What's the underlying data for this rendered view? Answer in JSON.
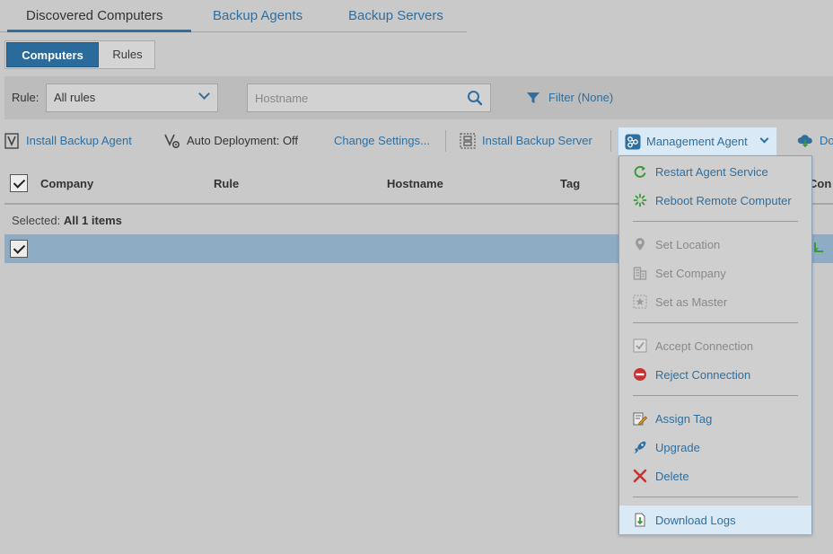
{
  "tabs": [
    {
      "label": "Discovered Computers",
      "active": true
    },
    {
      "label": "Backup Agents",
      "active": false
    },
    {
      "label": "Backup Servers",
      "active": false
    }
  ],
  "view_toggle": {
    "computers": "Computers",
    "rules": "Rules",
    "active": "Computers"
  },
  "filters": {
    "rule_label": "Rule:",
    "rule_value": "All rules",
    "search_placeholder": "Hostname",
    "filter_label": "Filter (None)"
  },
  "toolbar": {
    "install_agent": "Install Backup Agent",
    "auto_deployment": "Auto Deployment: Off",
    "change_settings": "Change Settings...",
    "install_server": "Install Backup Server",
    "management_agent": "Management Agent",
    "cut_off_item": "Do"
  },
  "table": {
    "columns": [
      "Company",
      "Rule",
      "Hostname",
      "Tag",
      "Con"
    ],
    "selected_prefix": "Selected:",
    "selected_value": "All 1 items"
  },
  "menu": {
    "items": [
      {
        "label": "Restart Agent Service",
        "icon": "restart-icon",
        "enabled": true
      },
      {
        "label": "Reboot Remote Computer",
        "icon": "reboot-icon",
        "enabled": true
      },
      {
        "label": "Set Location",
        "icon": "location-pin-icon",
        "enabled": false
      },
      {
        "label": "Set Company",
        "icon": "building-icon",
        "enabled": false
      },
      {
        "label": "Set as Master",
        "icon": "star-icon",
        "enabled": false
      },
      {
        "label": "Accept Connection",
        "icon": "checkbox-icon",
        "enabled": false
      },
      {
        "label": "Reject Connection",
        "icon": "no-entry-icon",
        "enabled": true
      },
      {
        "label": "Assign Tag",
        "icon": "tag-edit-icon",
        "enabled": true
      },
      {
        "label": "Upgrade",
        "icon": "upgrade-icon",
        "enabled": true
      },
      {
        "label": "Delete",
        "icon": "delete-x-icon",
        "enabled": true
      },
      {
        "label": "Download Logs",
        "icon": "download-logs-icon",
        "enabled": true,
        "highlighted": true
      }
    ]
  },
  "colors": {
    "accent": "#2f6f9f",
    "selected_row": "#8facc5",
    "delete_red": "#c83232",
    "restart_green": "#3a9a3a"
  }
}
